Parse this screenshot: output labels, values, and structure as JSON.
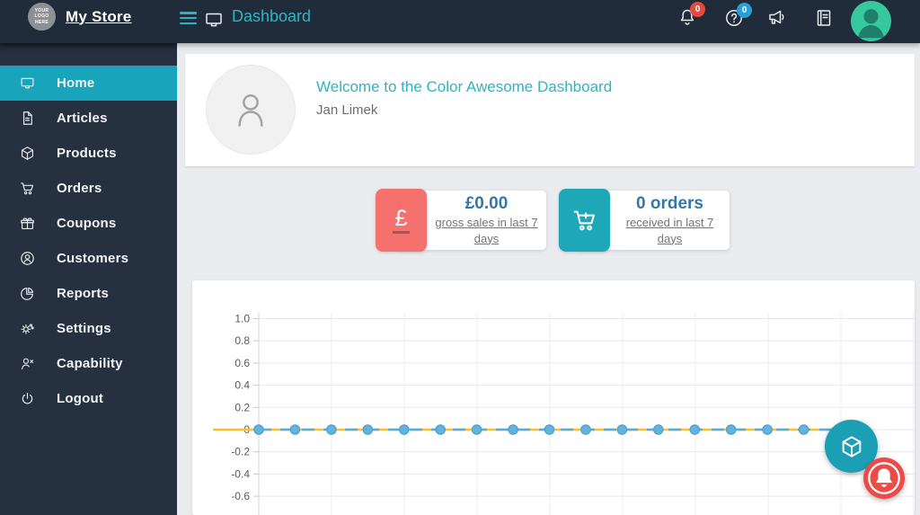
{
  "header": {
    "logo_lines": [
      "YOUR",
      "LOGO",
      "HERE"
    ],
    "store_name": "My Store",
    "page_title": "Dashboard",
    "notifications_badge": "0",
    "help_badge": "0"
  },
  "sidebar": {
    "items": [
      {
        "label": "Home",
        "icon": "laptop",
        "active": true
      },
      {
        "label": "Articles",
        "icon": "file",
        "active": false
      },
      {
        "label": "Products",
        "icon": "cube",
        "active": false
      },
      {
        "label": "Orders",
        "icon": "cart",
        "active": false
      },
      {
        "label": "Coupons",
        "icon": "gift",
        "active": false
      },
      {
        "label": "Customers",
        "icon": "person-circle",
        "active": false
      },
      {
        "label": "Reports",
        "icon": "pie",
        "active": false
      },
      {
        "label": "Settings",
        "icon": "gears",
        "active": false
      },
      {
        "label": "Capability",
        "icon": "person-x",
        "active": false
      },
      {
        "label": "Logout",
        "icon": "power",
        "active": false
      }
    ]
  },
  "welcome": {
    "title": "Welcome to the Color Awesome Dashboard",
    "user_name": "Jan Limek"
  },
  "stats": [
    {
      "value": "£0.00",
      "label": "gross sales in last 7 days",
      "icon": "pound",
      "tile_color": "#f4716d"
    },
    {
      "value": "0 orders",
      "label": "received in last 7 days",
      "icon": "cart-plus",
      "tile_color": "#1ea7b6"
    }
  ],
  "chart_data": {
    "type": "line",
    "title": "",
    "x_labels": [],
    "x_count": 17,
    "series": [
      {
        "name": "blue-dashed-markers",
        "color": "#58acdb",
        "marker_fill": "#64b2de",
        "marker_edge": "#4d9fd2",
        "style": "dashed",
        "values": [
          0,
          0,
          0,
          0,
          0,
          0,
          0,
          0,
          0,
          0,
          0,
          0,
          0,
          0,
          0,
          0,
          0
        ]
      },
      {
        "name": "orange-solid-baseline",
        "color": "#fcbf2e",
        "style": "solid",
        "values": [
          0,
          0,
          0,
          0,
          0,
          0,
          0,
          0,
          0,
          0,
          0,
          0,
          0,
          0,
          0,
          0,
          0
        ]
      }
    ],
    "yticks": [
      1.0,
      0.8,
      0.6,
      0.4,
      0.2,
      0,
      -0.2,
      -0.4,
      -0.6
    ],
    "ytick_labels": [
      "1.0",
      "0.8",
      "0.6",
      "0.4",
      "0.2",
      "0",
      "-0.2",
      "-0.4",
      "-0.6"
    ],
    "ylim": [
      -0.7,
      1.08
    ],
    "grid": true,
    "legend": "none"
  },
  "fabs": [
    {
      "name": "products-fab",
      "icon": "cube",
      "color": "#1b9fb4"
    },
    {
      "name": "alerts-fab",
      "icon": "bell-ring",
      "color": "#ec4b47"
    }
  ],
  "colors": {
    "header_bg": "#212c3a",
    "sidebar_bg": "#263140",
    "accent_teal": "#18a4ba",
    "content_bg": "#e9ebee",
    "stat_value_blue": "#3178ae",
    "coral": "#f4716d",
    "badge_red": "#e8473e",
    "badge_blue": "#2a9fd3"
  }
}
